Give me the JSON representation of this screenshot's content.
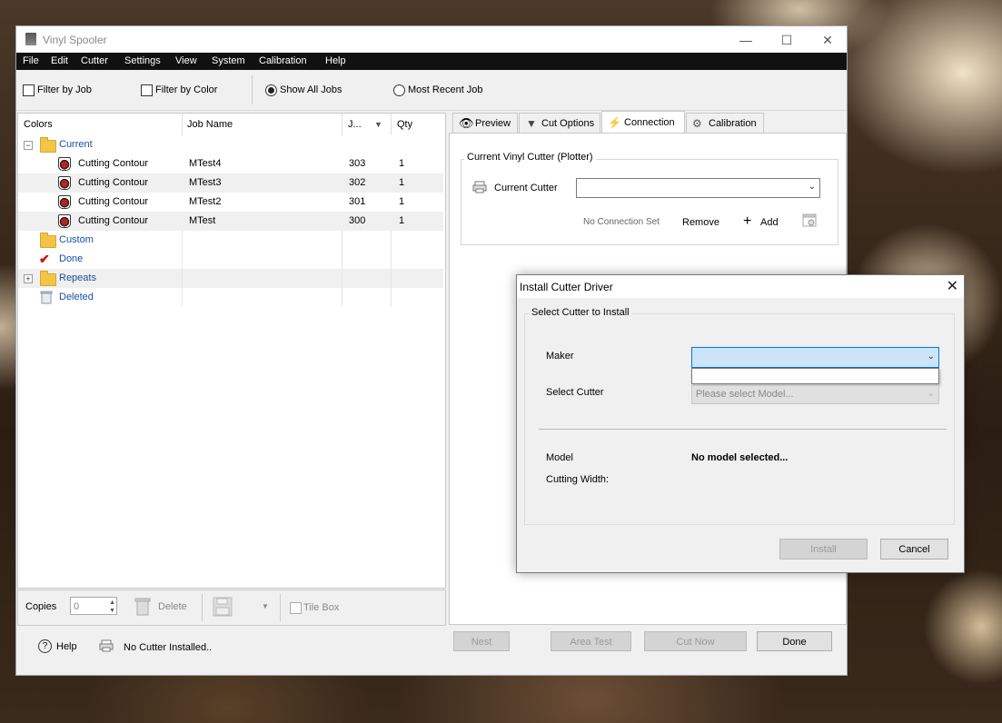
{
  "window": {
    "title": "Vinyl Spooler",
    "controls": [
      "—",
      "☐",
      "✕"
    ]
  },
  "menu": [
    "File",
    "Edit",
    "Cutter",
    "Settings",
    "View",
    "System",
    "Calibration",
    "Help"
  ],
  "toolbar": {
    "filter_by_job": "Filter by Job",
    "filter_by_color": "Filter by Color",
    "show_all_jobs": "Show All Jobs",
    "most_recent_job": "Most Recent Job"
  },
  "jobs": {
    "headers": {
      "colors": "Colors",
      "job_name": "Job Name",
      "job_num": "J...",
      "qty": "Qty"
    },
    "groups": {
      "current": "Current",
      "custom": "Custom",
      "done": "Done",
      "repeats": "Repeats",
      "deleted": "Deleted"
    },
    "rows": [
      {
        "color": "Cutting Contour",
        "name": "MTest4",
        "num": "303",
        "qty": "1"
      },
      {
        "color": "Cutting Contour",
        "name": "MTest3",
        "num": "302",
        "qty": "1"
      },
      {
        "color": "Cutting Contour",
        "name": "MTest2",
        "num": "301",
        "qty": "1"
      },
      {
        "color": "Cutting Contour",
        "name": "MTest",
        "num": "300",
        "qty": "1"
      }
    ]
  },
  "bottom": {
    "copies_label": "Copies",
    "copies_value": "0",
    "delete": "Delete",
    "tile_box": "Tile Box"
  },
  "footer": {
    "help": "Help",
    "status": "No Cutter Installed..",
    "nest": "Nest",
    "area_test": "Area Test",
    "cut_now": "Cut Now",
    "done": "Done"
  },
  "tabs": [
    "Preview",
    "Cut Options",
    "Connection",
    "Calibration"
  ],
  "connection": {
    "group_title": "Current Vinyl Cutter (Plotter)",
    "current_cutter_label": "Current Cutter",
    "current_cutter_value": "",
    "no_connection": "No Connection Set",
    "remove": "Remove",
    "add": "Add"
  },
  "dialog": {
    "title": "Install Cutter Driver",
    "group_title": "Select Cutter to Install",
    "maker_label": "Maker",
    "maker_value": "",
    "select_cutter_label": "Select Cutter",
    "select_cutter_placeholder": "Please select Model...",
    "model_label": "Model",
    "model_value": "No model selected...",
    "cutting_width_label": "Cutting Width:",
    "install": "Install",
    "cancel": "Cancel"
  }
}
